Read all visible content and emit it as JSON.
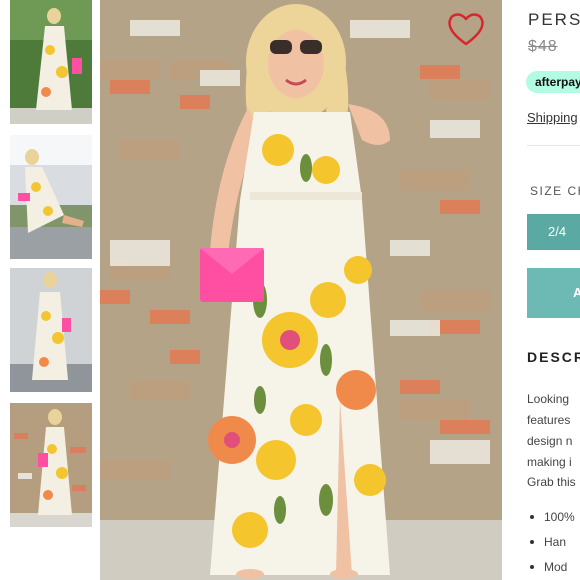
{
  "product": {
    "title": "PERS",
    "price_old": "$48",
    "afterpay_label": "afterpay",
    "shipping_link": "Shipping",
    "size_label": "SIZE CH",
    "size_option": "2/4",
    "add_button": "A",
    "description_title": "DESCR",
    "description_lines": [
      "Looking",
      "features",
      "design n",
      "making i",
      "Grab this"
    ],
    "bullets": [
      "100%",
      "Han",
      "Mod"
    ]
  },
  "thumbnails": [
    {
      "icon": "dress-photo-thumbnail"
    },
    {
      "icon": "seated-pose-thumbnail"
    },
    {
      "icon": "back-view-thumbnail"
    },
    {
      "icon": "brick-wall-thumbnail"
    }
  ],
  "icons": {
    "favorite": "heart-icon"
  },
  "colors": {
    "accent_teal": "#5aa9a3",
    "afterpay": "#b2fce4",
    "heart": "#d8262f"
  }
}
